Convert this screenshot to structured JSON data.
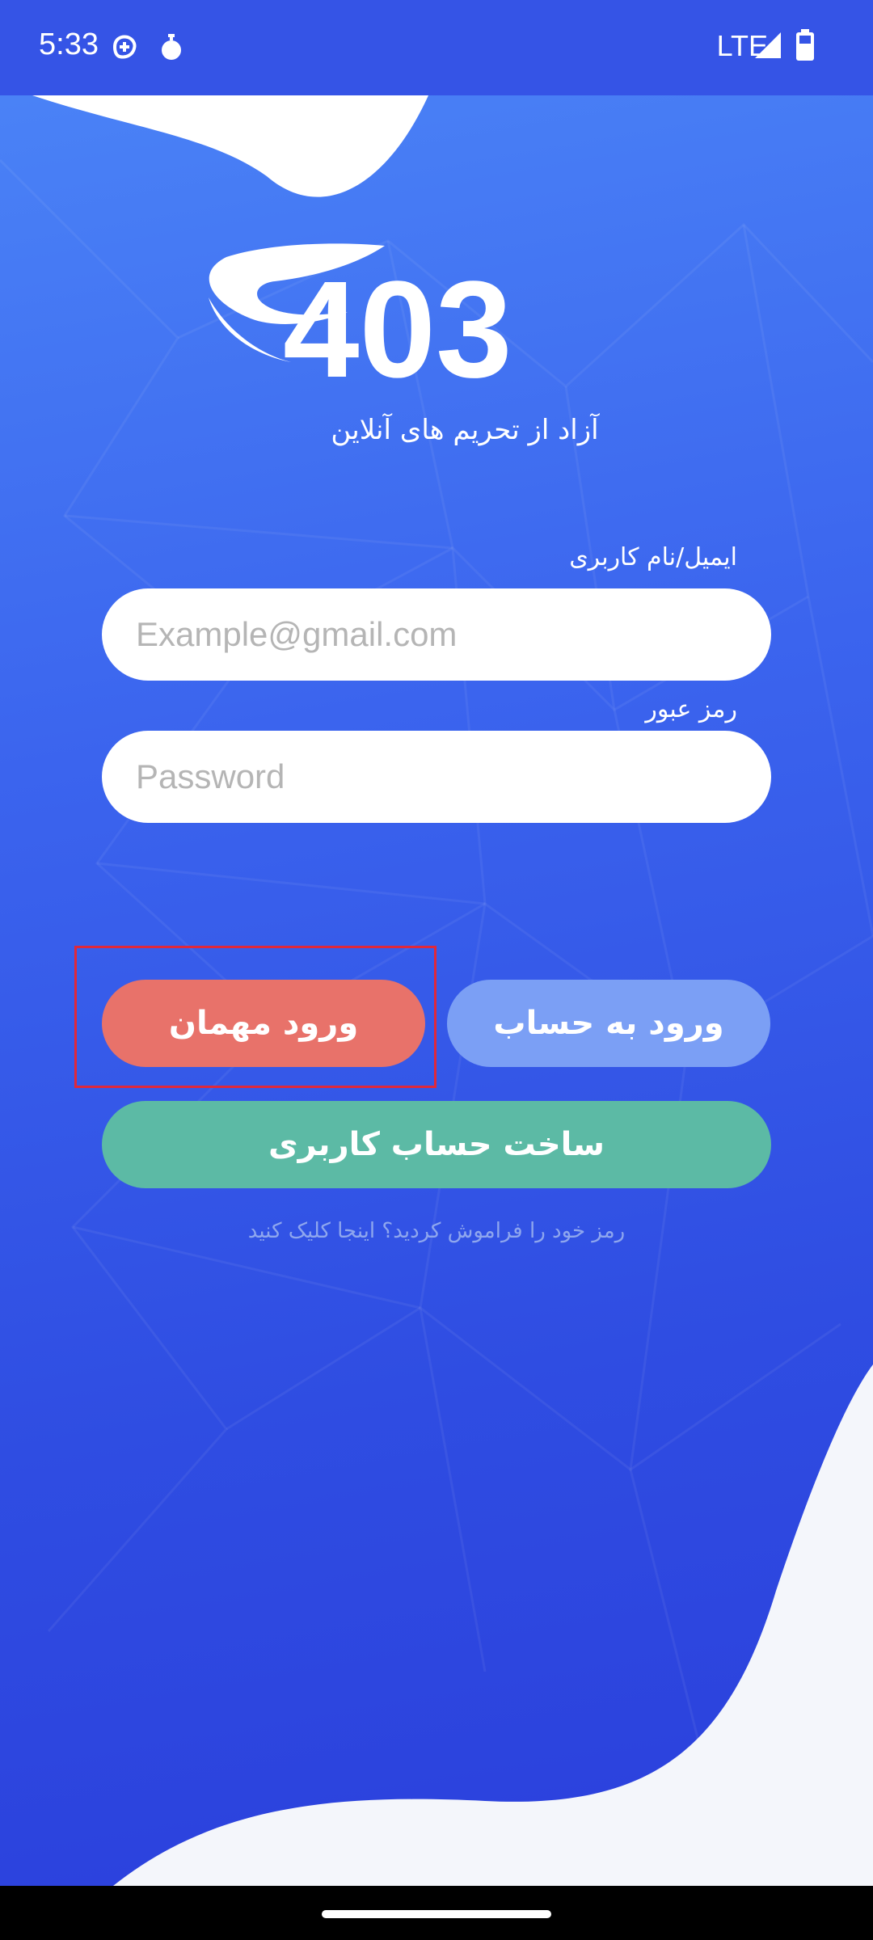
{
  "status_bar": {
    "time": "5:33",
    "network": "LTE"
  },
  "brand": {
    "logo_text": "403",
    "tagline": "آزاد از تحریم های آنلاین"
  },
  "form": {
    "email_label": "ایمیل/نام کاربری",
    "email_placeholder": "Example@gmail.com",
    "email_value": "",
    "password_label": "رمز عبور",
    "password_placeholder": "Password",
    "password_value": ""
  },
  "buttons": {
    "guest_label": "ورود مهمان",
    "login_label": "ورود به حساب",
    "signup_label": "ساخت حساب کاربری"
  },
  "forgot_text": "رمز خود را فراموش کردید؟ اینجا کلیک کنید",
  "colors": {
    "background": "#3b64ee",
    "guest_button": "#e8726a",
    "login_button": "#7b9ff5",
    "signup_button": "#5cbaa5",
    "highlight_border": "#e0283a"
  }
}
